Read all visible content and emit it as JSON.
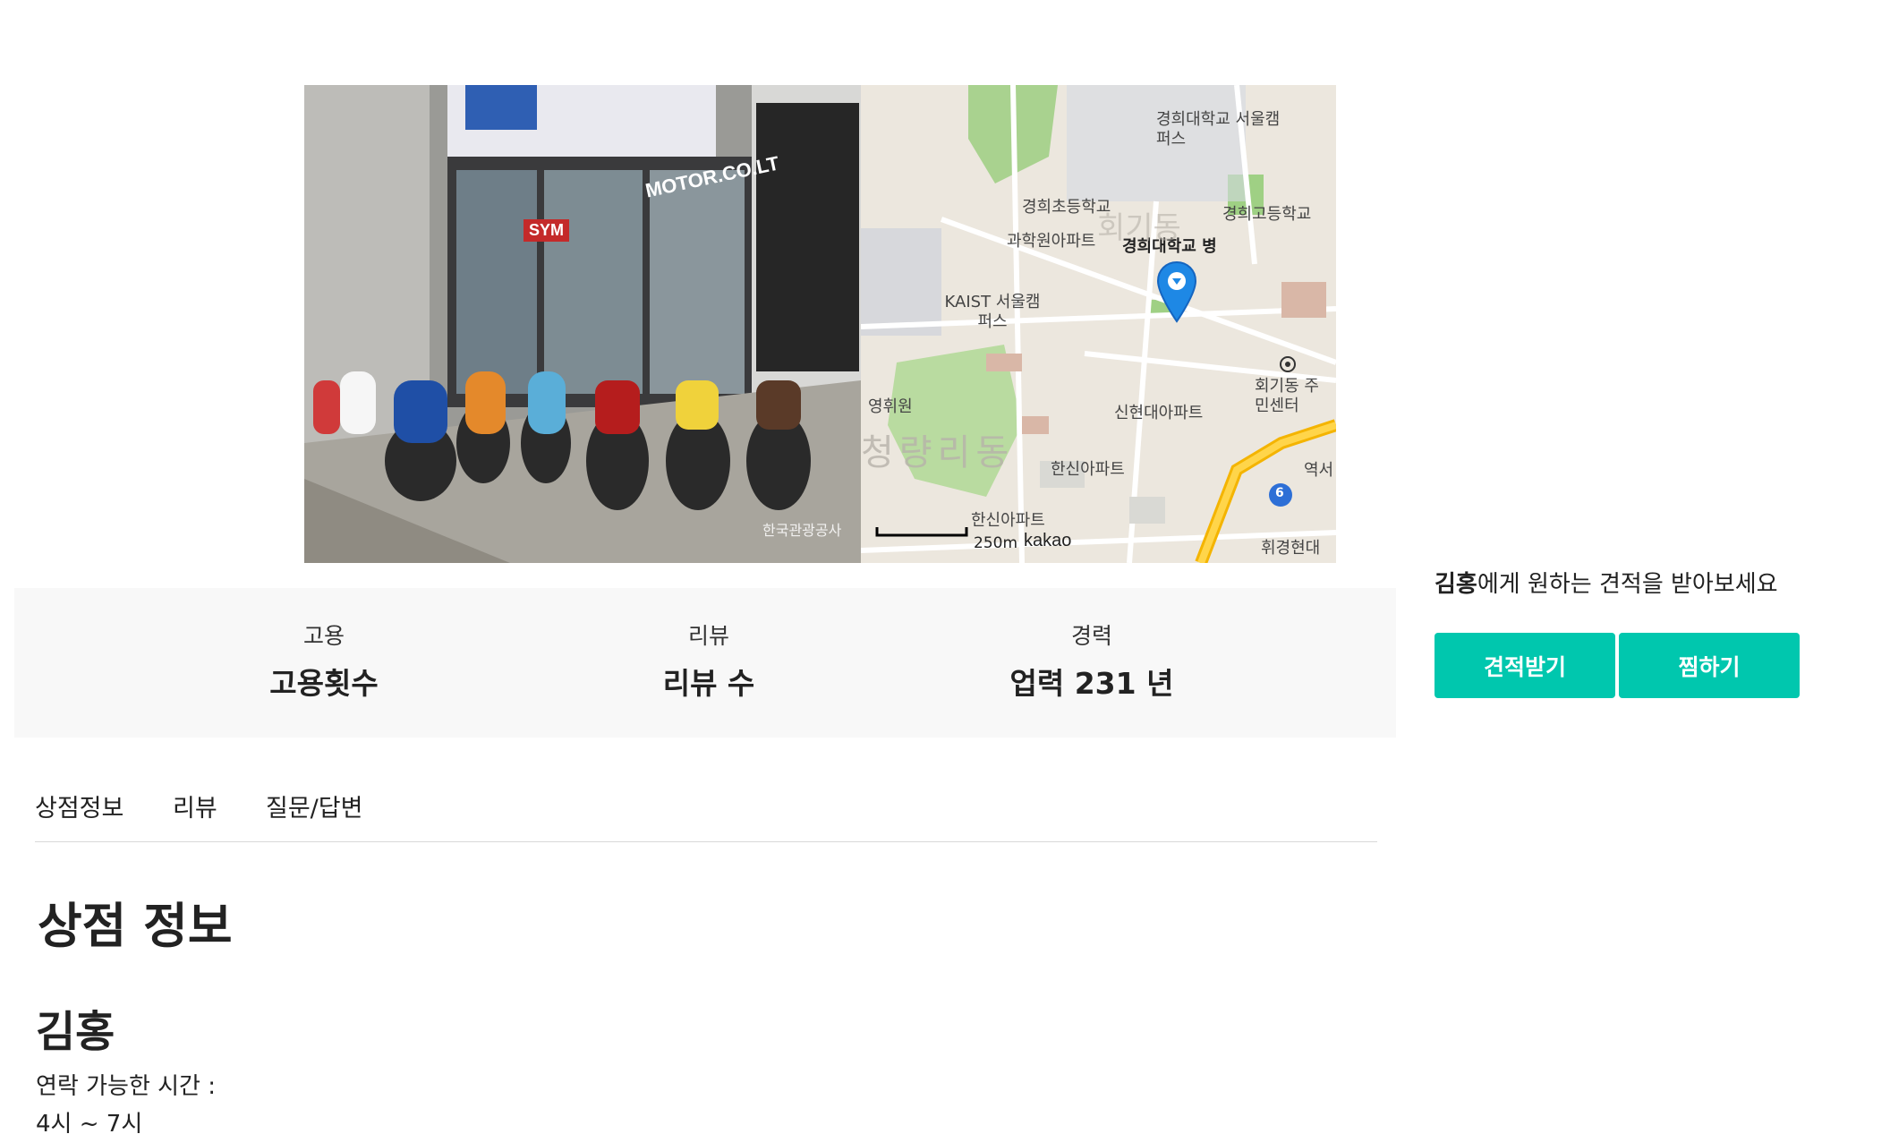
{
  "hero": {
    "photo": {
      "sign_text": "MOTOR.CO.LT",
      "brand_sign": "SYM",
      "watermark": "한국관광공사"
    },
    "map": {
      "labels": [
        "경희대학교 서울캠퍼스",
        "경희초등학교",
        "경희고등학교",
        "과학원아파트",
        "경희대학교 병",
        "KAIST 서울캠퍼스",
        "회기동 주민센터",
        "영휘원",
        "신현대아파트",
        "청량리동",
        "한신아파트",
        "한신아파트",
        "역서",
        "휘경현대",
        "회기동"
      ],
      "road_badge": "6",
      "scale_label": "250m",
      "brand": "kakao",
      "marker_color": "#1e88e5"
    }
  },
  "stats": [
    {
      "label": "고용",
      "value": "고용횟수"
    },
    {
      "label": "리뷰",
      "value": "리뷰 수"
    },
    {
      "label": "경력",
      "value": "업력 231 년"
    }
  ],
  "tabs": [
    "상점정보",
    "리뷰",
    "질문/답변"
  ],
  "section": {
    "title": "상점 정보"
  },
  "shop": {
    "name": "김홍",
    "hours_label": "연락 가능한 시간 :",
    "hours_value": "4시 ~ 7시"
  },
  "quote": {
    "name": "김홍",
    "suffix": "에게 원하는 견적을 받아보세요",
    "primary_button": "견적받기",
    "secondary_button": "찜하기",
    "accent_color": "#00c7ae"
  }
}
